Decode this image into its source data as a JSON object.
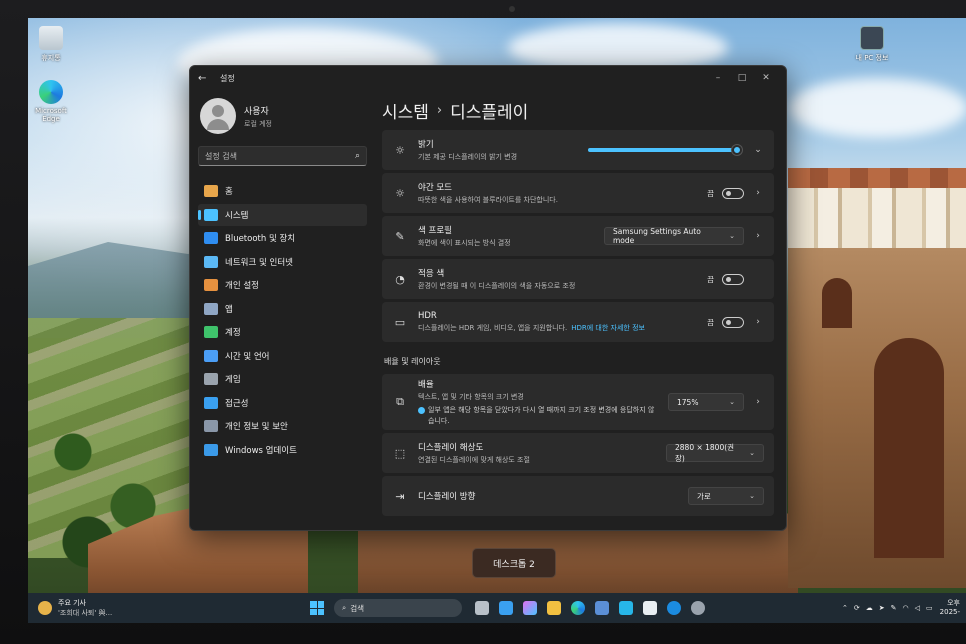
{
  "desktop": {
    "icons": [
      {
        "label": "휴지통"
      },
      {
        "label": "Microsoft Edge"
      },
      {
        "label": "내 PC 정보"
      }
    ],
    "desktop_switch_label": "데스크톱 2"
  },
  "window": {
    "title": "설정",
    "back_glyph": "←",
    "min_glyph": "–",
    "max_glyph": "□",
    "close_glyph": "✕"
  },
  "sidebar": {
    "user_name": "사용자",
    "user_sub": "로컬 계정",
    "search_placeholder": "설정 검색",
    "items": [
      {
        "label": "홈",
        "icon": "home-icon",
        "color": "#e8a64b"
      },
      {
        "label": "시스템",
        "icon": "system-icon",
        "color": "#4cc2ff",
        "active": true
      },
      {
        "label": "Bluetooth 및 장치",
        "icon": "bluetooth-icon",
        "color": "#2f8df0"
      },
      {
        "label": "네트워크 및 인터넷",
        "icon": "wifi-icon",
        "color": "#5bb8f5"
      },
      {
        "label": "개인 설정",
        "icon": "brush-icon",
        "color": "#e6913f"
      },
      {
        "label": "앱",
        "icon": "apps-icon",
        "color": "#8fa6c4"
      },
      {
        "label": "계정",
        "icon": "account-icon",
        "color": "#3fc36b"
      },
      {
        "label": "시간 및 언어",
        "icon": "globe-icon",
        "color": "#4b9ef5"
      },
      {
        "label": "게임",
        "icon": "gamepad-icon",
        "color": "#9aa3ad"
      },
      {
        "label": "접근성",
        "icon": "accessibility-icon",
        "color": "#3aa0f0"
      },
      {
        "label": "개인 정보 및 보안",
        "icon": "shield-icon",
        "color": "#8a97a8"
      },
      {
        "label": "Windows 업데이트",
        "icon": "update-icon",
        "color": "#3b9ae8"
      }
    ]
  },
  "main": {
    "breadcrumb_parent": "시스템",
    "breadcrumb_sep": "›",
    "breadcrumb_current": "디스플레이",
    "brightness": {
      "title": "밝기",
      "sub": "기본 제공 디스플레이의 밝기 변경",
      "level_percent": 100
    },
    "night_light": {
      "title": "야간 모드",
      "sub": "따뜻한 색을 사용하여 블루라이트를 차단합니다.",
      "state": "끔"
    },
    "color_profile": {
      "title": "색 프로필",
      "sub": "화면에 색이 표시되는 방식 결정",
      "value": "Samsung Settings Auto mode"
    },
    "adaptive_color": {
      "title": "적응 색",
      "sub": "환경이 변경될 때 이 디스플레이의 색을 자동으로 조정",
      "state": "끔"
    },
    "hdr": {
      "title": "HDR",
      "sub": "디스플레이는 HDR 게임, 비디오, 앱을 지원합니다.",
      "link": "HDR에 대한 자세한 정보",
      "state": "끔"
    },
    "section_scale": "배율 및 레이아웃",
    "scale": {
      "title": "배율",
      "sub": "텍스트, 앱 및 기타 항목의 크기 변경",
      "warning": "일부 앱은 해당 항목을 닫았다가 다시 열 때까지 크기 조정 변경에 응답하지 않습니다.",
      "value": "175%"
    },
    "resolution": {
      "title": "디스플레이 해상도",
      "sub": "연결된 디스플레이에 맞게 해상도 조절",
      "value": "2880 × 1800(권장)"
    },
    "orientation": {
      "title": "디스플레이 방향",
      "value": "가로"
    }
  },
  "taskbar": {
    "news_title": "주요 기사",
    "news_sub": "'조희대 사퇴' 與...",
    "search_placeholder": "검색",
    "clock_time": "오후",
    "clock_date": "2025-"
  }
}
